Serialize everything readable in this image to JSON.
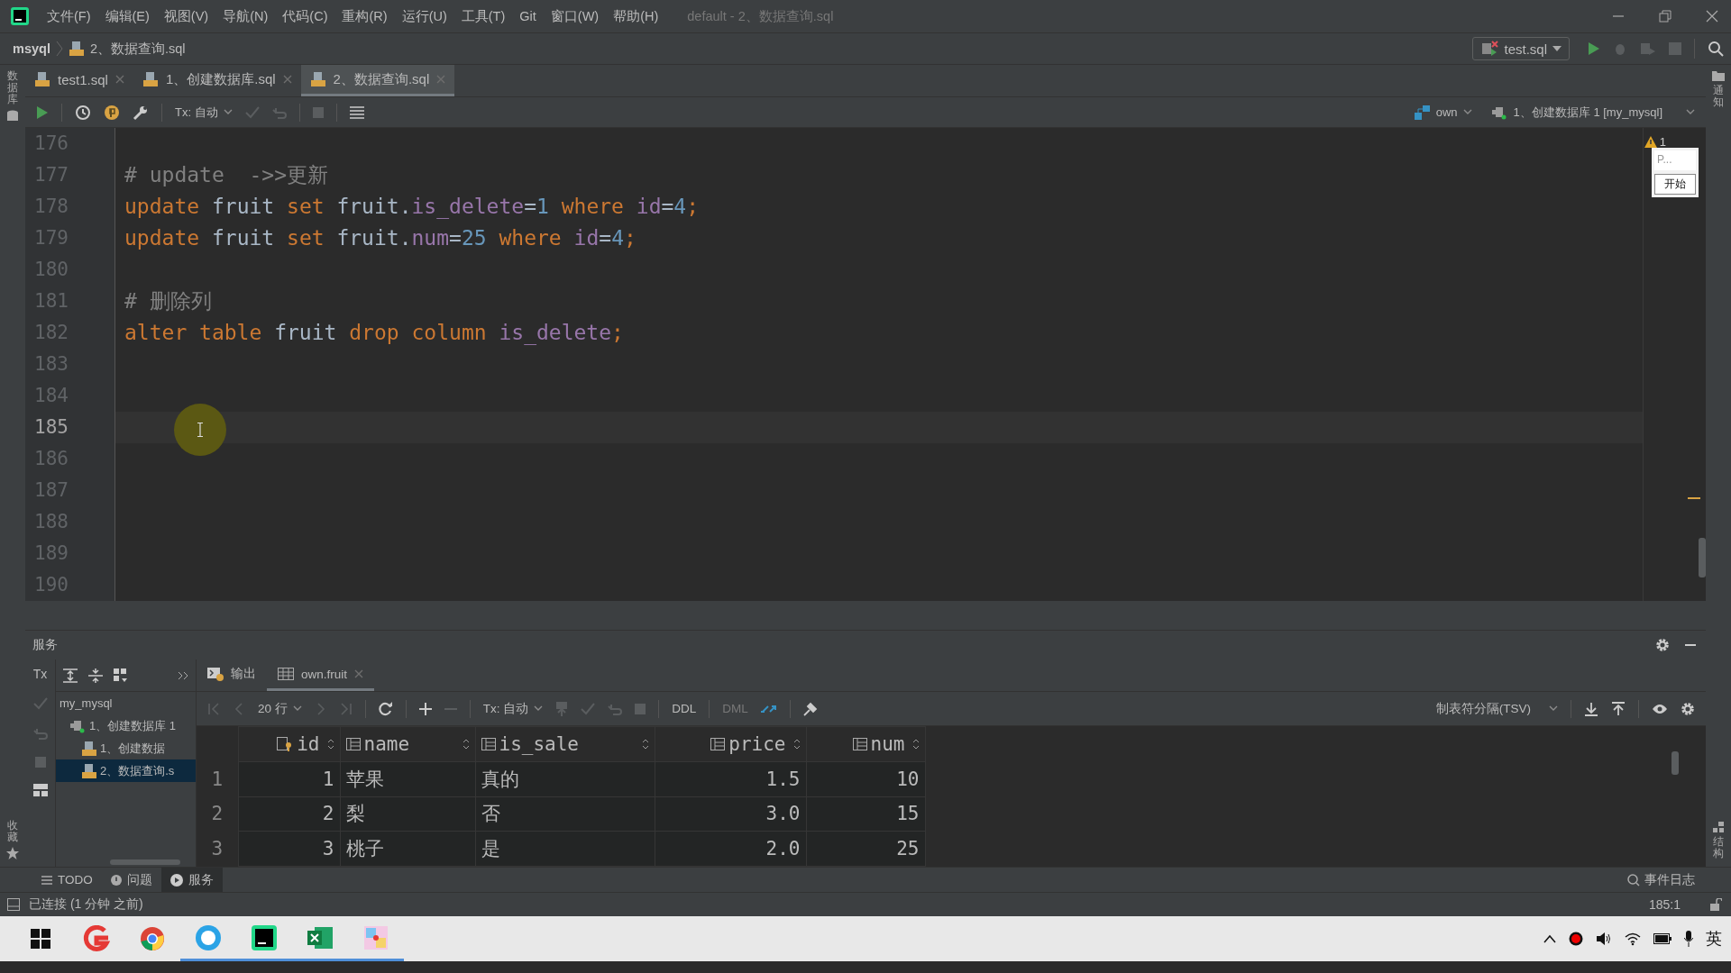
{
  "title_bar": {
    "menu": [
      "文件(F)",
      "编辑(E)",
      "视图(V)",
      "导航(N)",
      "代码(C)",
      "重构(R)",
      "运行(U)",
      "工具(T)",
      "Git",
      "窗口(W)",
      "帮助(H)"
    ],
    "title": "default - 2、数据查询.sql"
  },
  "breadcrumb": {
    "project": "msyql",
    "file": "2、数据查询.sql"
  },
  "run_config": {
    "label": "test.sql"
  },
  "side_labels": {
    "left_top": "数据库",
    "left_bottom": "收藏",
    "right_top": "通知",
    "right_bottom": "结构"
  },
  "tabs": [
    {
      "label": "test1.sql",
      "selected": false
    },
    {
      "label": "1、创建数据库.sql",
      "selected": false
    },
    {
      "label": "2、数据查询.sql",
      "selected": true
    }
  ],
  "editor_toolbar": {
    "tx": "Tx: 自动",
    "schema": "own",
    "datasource": "1、创建数据库 1 [my_mysql]"
  },
  "editor": {
    "warning_count": "1",
    "popup": {
      "text": "P...",
      "button": "开始"
    },
    "lines": [
      {
        "number": "176",
        "current": false
      },
      {
        "number": "177",
        "current": false,
        "tokens": [
          {
            "kind": "comment",
            "text": "# update  ->>更新"
          }
        ]
      },
      {
        "number": "178",
        "current": false,
        "tokens": [
          {
            "kind": "keyword",
            "text": "update"
          },
          {
            "kind": "ident",
            "text": " fruit "
          },
          {
            "kind": "keyword",
            "text": "set"
          },
          {
            "kind": "ident",
            "text": " fruit."
          },
          {
            "kind": "column",
            "text": "is_delete"
          },
          {
            "kind": "ident",
            "text": "="
          },
          {
            "kind": "number",
            "text": "1"
          },
          {
            "kind": "keyword",
            "text": " where "
          },
          {
            "kind": "column",
            "text": "id"
          },
          {
            "kind": "ident",
            "text": "="
          },
          {
            "kind": "number",
            "text": "4"
          },
          {
            "kind": "keyword",
            "text": ";"
          }
        ]
      },
      {
        "number": "179",
        "current": false,
        "tokens": [
          {
            "kind": "keyword",
            "text": "update"
          },
          {
            "kind": "ident",
            "text": " fruit "
          },
          {
            "kind": "keyword",
            "text": "set"
          },
          {
            "kind": "ident",
            "text": " fruit."
          },
          {
            "kind": "column",
            "text": "num"
          },
          {
            "kind": "ident",
            "text": "="
          },
          {
            "kind": "number",
            "text": "25"
          },
          {
            "kind": "keyword",
            "text": " where "
          },
          {
            "kind": "column",
            "text": "id"
          },
          {
            "kind": "ident",
            "text": "="
          },
          {
            "kind": "number",
            "text": "4"
          },
          {
            "kind": "keyword",
            "text": ";"
          }
        ]
      },
      {
        "number": "180",
        "current": false
      },
      {
        "number": "181",
        "current": false,
        "tokens": [
          {
            "kind": "comment",
            "text": "# 删除列"
          }
        ]
      },
      {
        "number": "182",
        "current": false,
        "tokens": [
          {
            "kind": "keyword",
            "text": "alter table"
          },
          {
            "kind": "ident",
            "text": " fruit "
          },
          {
            "kind": "keyword",
            "text": "drop column "
          },
          {
            "kind": "column",
            "text": "is_delete"
          },
          {
            "kind": "keyword",
            "text": ";"
          }
        ]
      },
      {
        "number": "183",
        "current": false
      },
      {
        "number": "184",
        "current": false
      },
      {
        "number": "185",
        "current": true
      },
      {
        "number": "186",
        "current": false
      },
      {
        "number": "187",
        "current": false
      },
      {
        "number": "188",
        "current": false
      },
      {
        "number": "189",
        "current": false
      },
      {
        "number": "190",
        "current": false
      }
    ]
  },
  "services": {
    "title": "服务",
    "tx_button": "Tx",
    "tree": [
      {
        "label": "my_mysql",
        "selected": false,
        "children": [
          {
            "label": "1、创建数据库 1",
            "kind": "session",
            "selected": false,
            "children": [
              {
                "label": "1、创建数据",
                "kind": "file",
                "selected": false
              },
              {
                "label": "2、数据查询.s",
                "kind": "file",
                "selected": true
              }
            ]
          }
        ]
      }
    ],
    "result_tabs": [
      {
        "label": "输出",
        "kind": "output",
        "selected": false
      },
      {
        "label": "own.fruit",
        "kind": "table",
        "selected": true
      }
    ],
    "result_toolbar": {
      "page_size": "20 行",
      "tx": "Tx: 自动",
      "ddl": "DDL",
      "dml": "DML",
      "format": "制表符分隔(TSV)"
    },
    "table": {
      "columns": [
        "id",
        "name",
        "is_sale",
        "price",
        "num"
      ],
      "rows": [
        {
          "number": "1",
          "cells": [
            "1",
            "苹果",
            "真的",
            "1.5",
            "10"
          ]
        },
        {
          "number": "2",
          "cells": [
            "2",
            "梨",
            "否",
            "3.0",
            "15"
          ]
        },
        {
          "number": "3",
          "cells": [
            "3",
            "桃子",
            "是",
            "2.0",
            "25"
          ]
        }
      ]
    }
  },
  "tool_tabs": [
    {
      "label": "TODO",
      "selected": false
    },
    {
      "label": "问题",
      "selected": false
    },
    {
      "label": "服务",
      "selected": true
    }
  ],
  "event_log": "事件日志",
  "status_bar": {
    "message": "已连接 (1 分钟 之前)",
    "position": "185:1"
  },
  "taskbar": {
    "ime": "英"
  }
}
